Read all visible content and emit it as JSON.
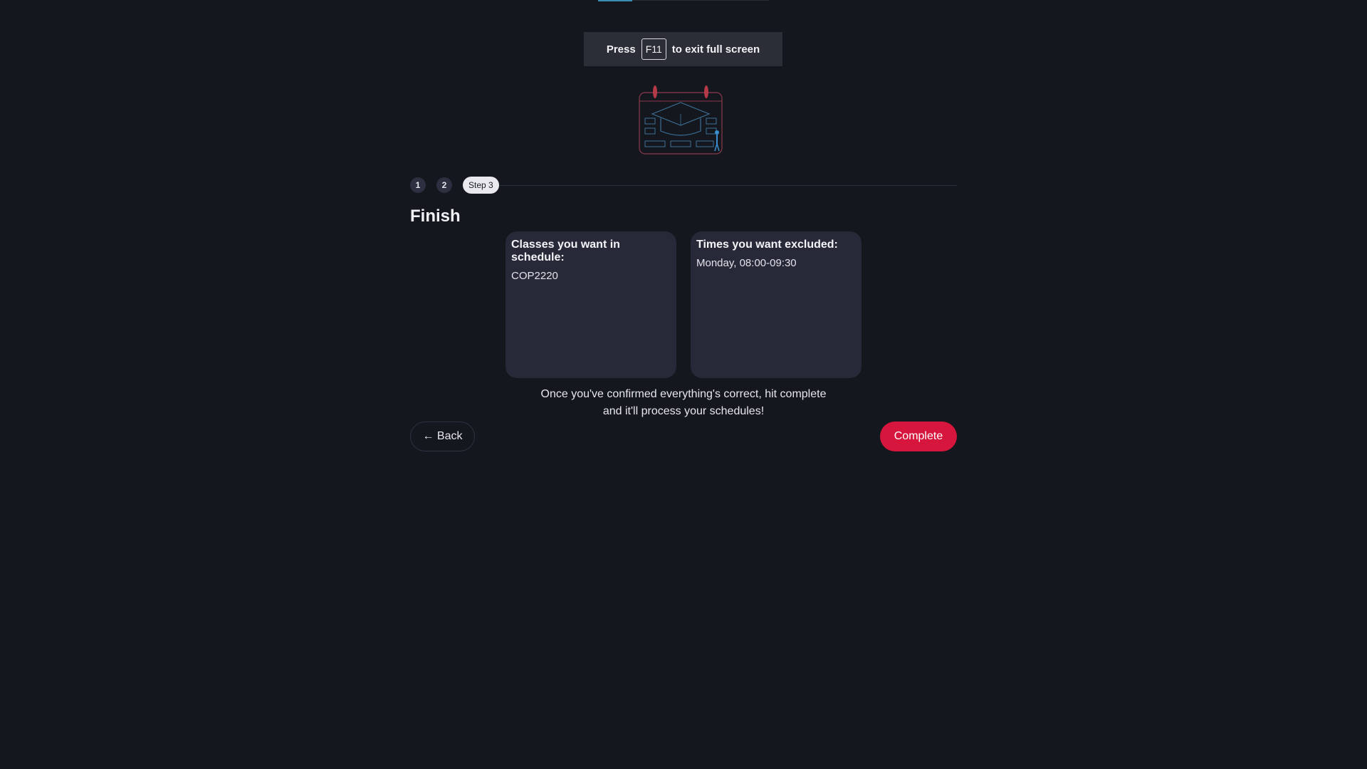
{
  "toast": {
    "prefix": "Press",
    "key": "F11",
    "suffix": "to exit full screen"
  },
  "stepper": {
    "steps": [
      "1",
      "2"
    ],
    "current": "Step 3"
  },
  "section": {
    "title": "Finish"
  },
  "cards": {
    "classes": {
      "title": "Classes you want in schedule:",
      "items": [
        "COP2220"
      ]
    },
    "times": {
      "title": "Times you want excluded:",
      "items": [
        "Monday, 08:00-09:30"
      ]
    }
  },
  "note": {
    "line1": "Once you've confirmed everything's correct, hit complete",
    "line2": "and it'll process your schedules!"
  },
  "buttons": {
    "back": "← Back",
    "complete": "Complete"
  },
  "colors": {
    "background": "#15171f",
    "card": "#272939",
    "accent": "#d6163c"
  }
}
